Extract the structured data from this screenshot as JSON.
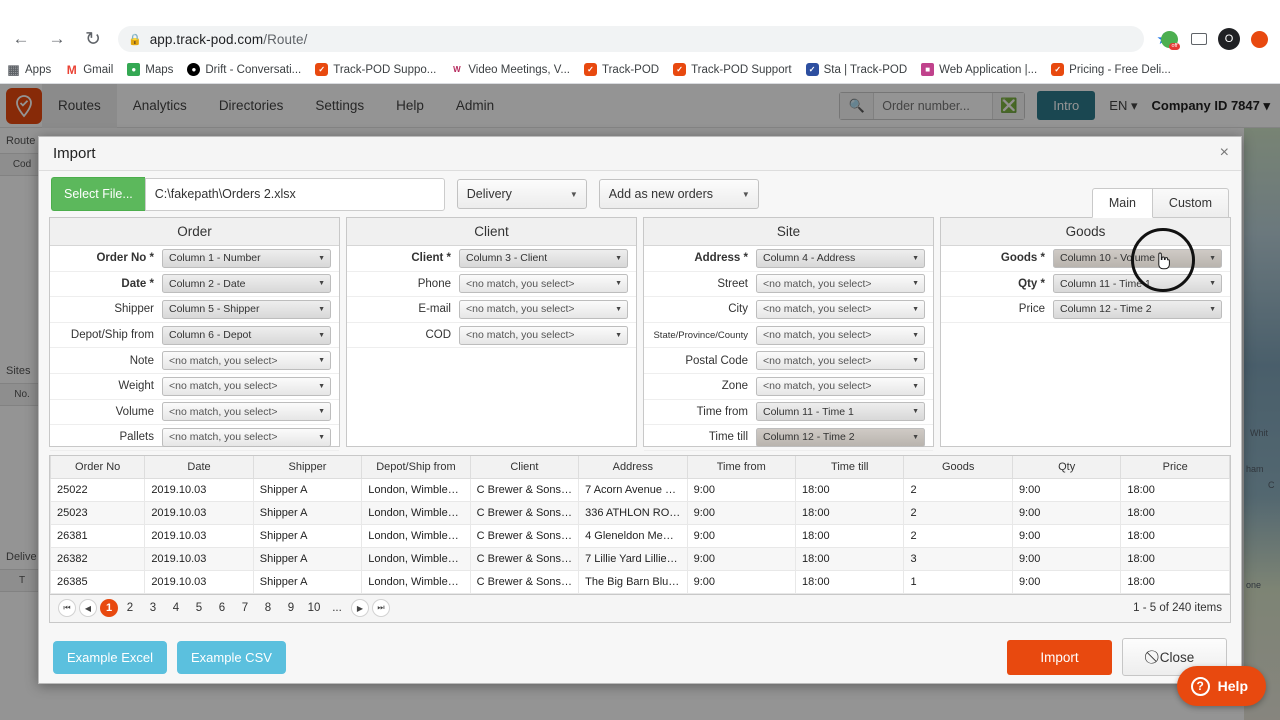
{
  "browser": {
    "url_host": "app.track-pod.com",
    "url_path": "/Route/",
    "lock_icon": "lock-icon",
    "back_icon": "back-arrow-icon",
    "forward_icon": "forward-arrow-icon",
    "reload_icon": "reload-icon",
    "star_icon": "bookmark-star-icon",
    "profile_initial": "O",
    "bookmarks": [
      {
        "label": "Apps",
        "icon": "apps-grid-icon"
      },
      {
        "label": "Gmail",
        "icon": "gmail-icon"
      },
      {
        "label": "Maps",
        "icon": "maps-icon"
      },
      {
        "label": "Drift - Conversati...",
        "icon": "drift-icon"
      },
      {
        "label": "Track-POD Suppo...",
        "icon": "trackpod-icon"
      },
      {
        "label": "Video Meetings, V...",
        "icon": "webex-icon"
      },
      {
        "label": "Track-POD",
        "icon": "trackpod-icon"
      },
      {
        "label": "Track-POD Support",
        "icon": "trackpod-icon"
      },
      {
        "label": "Sta | Track-POD",
        "icon": "stats-icon"
      },
      {
        "label": "Web Application |...",
        "icon": "web-app-icon"
      },
      {
        "label": "Pricing - Free Deli...",
        "icon": "trackpod-icon"
      }
    ]
  },
  "app_header": {
    "logo_icon": "trackpod-logo-icon",
    "nav": [
      "Routes",
      "Analytics",
      "Directories",
      "Settings",
      "Help",
      "Admin"
    ],
    "active_nav": "Routes",
    "search_placeholder": "Order number...",
    "search_value": "",
    "search_icon": "search-icon",
    "clear_icon": "clear-circle-icon",
    "intro_label": "Intro",
    "language": "EN",
    "company": "Company ID 7847"
  },
  "background": {
    "left_labels": [
      "Route",
      "Cod",
      "Sites",
      "No.",
      "Delive",
      "T"
    ],
    "map_labels": [
      "Whit",
      "ham",
      "C",
      "one"
    ]
  },
  "modal": {
    "title": "Import",
    "close_icon": "close-icon",
    "select_file_label": "Select File...",
    "file_path": "C:\\fakepath\\Orders 2.xlsx",
    "delivery_type": "Delivery",
    "import_mode": "Add as new orders",
    "tabs": [
      {
        "label": "Main",
        "active": true
      },
      {
        "label": "Custom",
        "active": false
      }
    ],
    "placeholder_option": "<no match, you select>",
    "panels": [
      {
        "title": "Order",
        "fields": [
          {
            "label": "Order No *",
            "required": true,
            "value": "Column 1 - Number",
            "filled": true
          },
          {
            "label": "Date *",
            "required": true,
            "value": "Column 2 - Date",
            "filled": true
          },
          {
            "label": "Shipper",
            "required": false,
            "value": "Column 5 - Shipper",
            "filled": true
          },
          {
            "label": "Depot/Ship from",
            "required": false,
            "value": "Column 6 - Depot",
            "filled": true
          },
          {
            "label": "Note",
            "required": false,
            "value": "<no match, you select>",
            "filled": false
          },
          {
            "label": "Weight",
            "required": false,
            "value": "<no match, you select>",
            "filled": false
          },
          {
            "label": "Volume",
            "required": false,
            "value": "<no match, you select>",
            "filled": false
          },
          {
            "label": "Pallets",
            "required": false,
            "value": "<no match, you select>",
            "filled": false
          }
        ]
      },
      {
        "title": "Client",
        "fields": [
          {
            "label": "Client *",
            "required": true,
            "value": "Column 3 - Client",
            "filled": true
          },
          {
            "label": "Phone",
            "required": false,
            "value": "<no match, you select>",
            "filled": false
          },
          {
            "label": "E-mail",
            "required": false,
            "value": "<no match, you select>",
            "filled": false
          },
          {
            "label": "COD",
            "required": false,
            "value": "<no match, you select>",
            "filled": false
          }
        ]
      },
      {
        "title": "Site",
        "fields": [
          {
            "label": "Address *",
            "required": true,
            "value": "Column 4 - Address",
            "filled": true
          },
          {
            "label": "Street",
            "required": false,
            "value": "<no match, you select>",
            "filled": false
          },
          {
            "label": "City",
            "required": false,
            "value": "<no match, you select>",
            "filled": false
          },
          {
            "label": "State/Province/County",
            "required": false,
            "small": true,
            "value": "<no match, you select>",
            "filled": false
          },
          {
            "label": "Postal Code",
            "required": false,
            "value": "<no match, you select>",
            "filled": false
          },
          {
            "label": "Zone",
            "required": false,
            "value": "<no match, you select>",
            "filled": false
          },
          {
            "label": "Time from",
            "required": false,
            "value": "Column 11 - Time 1",
            "filled": true
          },
          {
            "label": "Time till",
            "required": false,
            "value": "Column 12 - Time 2",
            "filled": true,
            "hot": true
          }
        ]
      },
      {
        "title": "Goods",
        "fields": [
          {
            "label": "Goods *",
            "required": true,
            "value": "Column 10 - Volume",
            "filled": true,
            "hot": true
          },
          {
            "label": "Qty *",
            "required": true,
            "value": "Column 11 - Time 1",
            "filled": true
          },
          {
            "label": "Price",
            "required": false,
            "value": "Column 12 - Time 2",
            "filled": true
          }
        ]
      }
    ],
    "table": {
      "columns": [
        "Order No",
        "Date",
        "Shipper",
        "Depot/Ship from",
        "Client",
        "Address",
        "Time from",
        "Time till",
        "Goods",
        "Qty",
        "Price"
      ],
      "rows": [
        [
          "25022",
          "2019.10.03",
          "Shipper A",
          "London, Wimbledo...",
          "C Brewer & Sons Lt...",
          "7 Acorn Avenue Br...",
          "9:00",
          "18:00",
          "2",
          "9:00",
          "18:00"
        ],
        [
          "25023",
          "2019.10.03",
          "Shipper A",
          "London, Wimbledo...",
          "C Brewer & Sons Lt...",
          "336 ATHLON ROAD...",
          "9:00",
          "18:00",
          "2",
          "9:00",
          "18:00"
        ],
        [
          "26381",
          "2019.10.03",
          "Shipper A",
          "London, Wimbledo...",
          "C Brewer & Sons Lt...",
          "4 Gleneldon Mews ...",
          "9:00",
          "18:00",
          "2",
          "9:00",
          "18:00"
        ],
        [
          "26382",
          "2019.10.03",
          "Shipper A",
          "London, Wimbledo...",
          "C Brewer & Sons Lt...",
          "7 Lillie Yard Lillie R...",
          "9:00",
          "18:00",
          "3",
          "9:00",
          "18:00"
        ],
        [
          "26385",
          "2019.10.03",
          "Shipper A",
          "London, Wimbledo...",
          "C Brewer & Sons Lt...",
          "The Big Barn Blueri...",
          "9:00",
          "18:00",
          "1",
          "9:00",
          "18:00"
        ]
      ]
    },
    "pagination": {
      "first_icon": "first-page-icon",
      "prev_icon": "prev-page-icon",
      "next_icon": "next-page-icon",
      "last_icon": "last-page-icon",
      "pages": [
        "1",
        "2",
        "3",
        "4",
        "5",
        "6",
        "7",
        "8",
        "9",
        "10",
        "..."
      ],
      "current": "1",
      "info": "1 - 5 of 240 items"
    },
    "footer": {
      "example_excel": "Example Excel",
      "example_csv": "Example CSV",
      "import": "Import",
      "close": "Close",
      "close_icon": "no-entry-icon"
    }
  },
  "help_widget": {
    "label": "Help",
    "icon": "question-mark-icon"
  },
  "colors": {
    "brand_orange": "#e8490f",
    "green_button": "#5cb85c",
    "cyan_button": "#5bc0de",
    "teal_button": "#2d7b8c"
  }
}
